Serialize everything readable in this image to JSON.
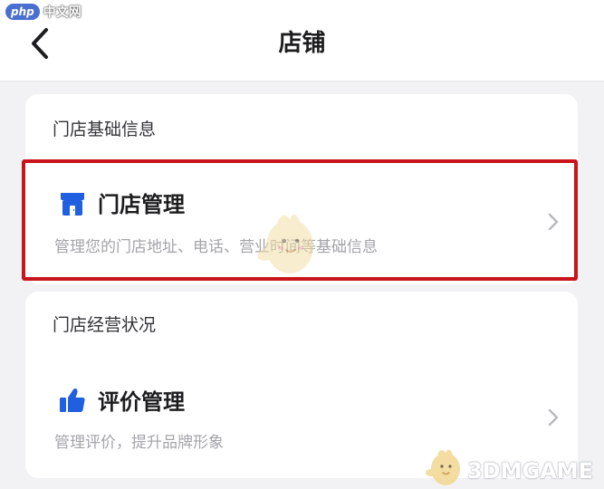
{
  "watermark": {
    "badge": "php",
    "text": "中文网",
    "brand": "3DMGAME"
  },
  "header": {
    "title": "店铺",
    "back_icon": "chevron-left-icon"
  },
  "sections": [
    {
      "label": "门店基础信息",
      "item": {
        "title": "门店管理",
        "description": "管理您的门店地址、电话、营业时间等基础信息",
        "icon": "store-icon",
        "highlighted": true
      }
    },
    {
      "label": "门店经营状况",
      "item": {
        "title": "评价管理",
        "description": "管理评价，提升品牌形象",
        "icon": "thumbs-up-icon",
        "highlighted": false
      }
    }
  ],
  "colors": {
    "accent": "#1f5fe0",
    "highlight_border": "#c8141b",
    "background": "#f2f2f4",
    "muted_text": "#a4a4aa"
  }
}
